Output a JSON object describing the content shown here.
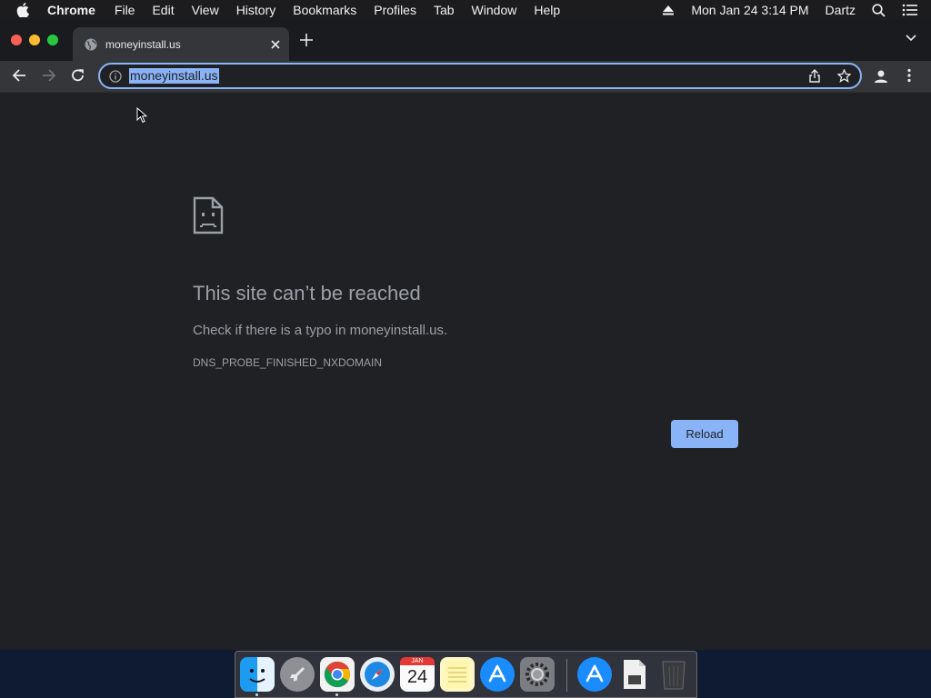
{
  "menubar": {
    "app_name": "Chrome",
    "items": [
      "File",
      "Edit",
      "View",
      "History",
      "Bookmarks",
      "Profiles",
      "Tab",
      "Window",
      "Help"
    ],
    "clock": "Mon Jan 24  3:14 PM",
    "user": "Dartz"
  },
  "tab": {
    "title": "moneyinstall.us"
  },
  "omnibox": {
    "url": "moneyinstall.us"
  },
  "error_page": {
    "title": "This site can’t be reached",
    "message": "Check if there is a typo in moneyinstall.us.",
    "code": "DNS_PROBE_FINISHED_NXDOMAIN",
    "reload_label": "Reload"
  },
  "dock": {
    "calendar_month": "JAN",
    "calendar_day": "24",
    "items": [
      "finder",
      "launchpad",
      "chrome",
      "safari",
      "calendar",
      "notes",
      "app-store",
      "system-preferences",
      "app-store-download",
      "file",
      "trash"
    ]
  },
  "colors": {
    "accent": "#8ab4f8",
    "page_bg": "#202124",
    "text_secondary": "#9aa0a6"
  }
}
